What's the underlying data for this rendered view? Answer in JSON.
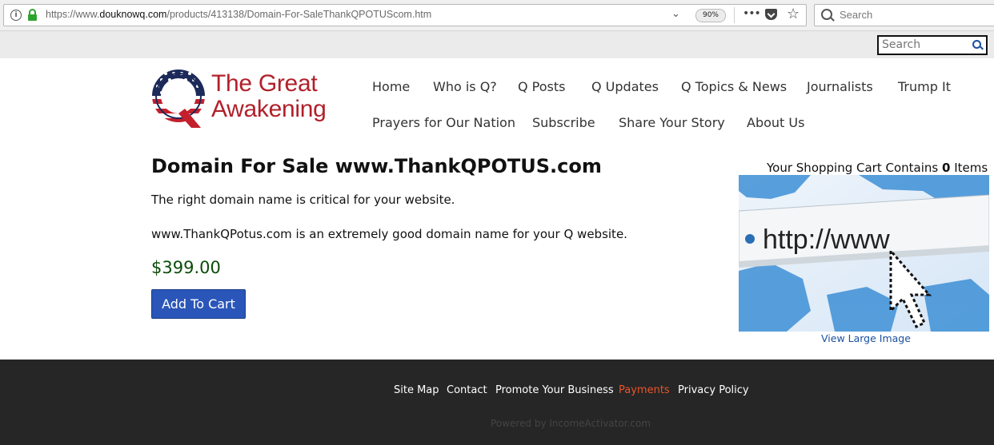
{
  "browser": {
    "url_prefix": "https://www.",
    "url_domain": "douknowq.com",
    "url_path": "/products/413138/Domain-For-SaleThankQPOTUScom.htm",
    "zoom": "90%",
    "search_placeholder": "Search"
  },
  "site_search": {
    "placeholder": "Search"
  },
  "logo": {
    "line1": "The Great",
    "line2": "Awakening"
  },
  "nav": {
    "row1": [
      "Home",
      "Who is Q?",
      "Q Posts",
      "Q Updates",
      "Q Topics & News",
      "Journalists",
      "Trump It"
    ],
    "row2": [
      "Prayers for Our Nation",
      "Subscribe",
      "Share Your Story",
      "About Us"
    ]
  },
  "product": {
    "title": "Domain For Sale www.ThankQPOTUS.com",
    "desc1": "The right domain name is critical for your website.",
    "desc2": "www.ThankQPotus.com is an extremely good domain name for your Q website.",
    "price": "$399.00",
    "add_to_cart": "Add To Cart",
    "image_text": "http://www",
    "view_large": "View Large Image"
  },
  "cart": {
    "prefix": "Your Shopping Cart Contains ",
    "count": "0",
    "suffix": " Items"
  },
  "footer": {
    "links": [
      "Site Map",
      "Contact",
      "Promote Your Business",
      "Payments",
      "Privacy Policy"
    ],
    "active": "Payments",
    "powered": "Powered by IncomeActivator.com"
  },
  "colors": {
    "brand_red": "#b1202a",
    "button_blue": "#2a56b9",
    "price_green": "#0a4c0a",
    "footer_bg": "#262626",
    "footer_active": "#e8552a"
  }
}
